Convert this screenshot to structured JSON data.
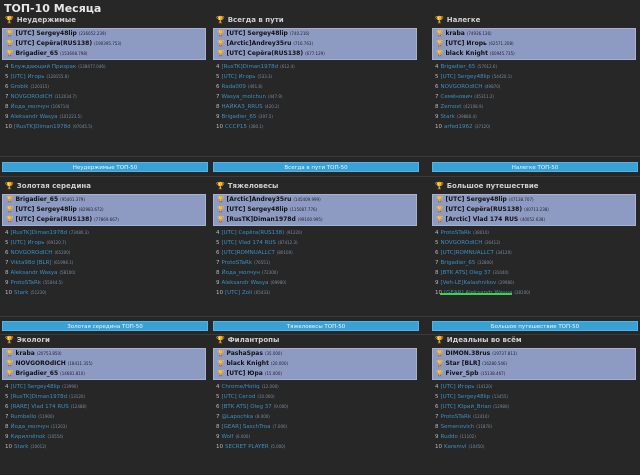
{
  "page_title": "ТОП-10 Месяца",
  "sections": [
    {
      "title": "Неудержимые",
      "top": [
        {
          "name": "[UTC] Sergey48lip",
          "score": "(236052.239)"
        },
        {
          "name": "[UTC] Cepёra(RUS138)",
          "score": "(190395.753)"
        },
        {
          "name": "Brigadier_65",
          "score": "(153608.798)"
        }
      ],
      "rest": [
        {
          "rank": "4",
          "name": "Блуждающий Призрак",
          "score": "(138477.046)"
        },
        {
          "name": "[UTC] Игорь",
          "score": "(128155.8)",
          "rank": "5"
        },
        {
          "rank": "6",
          "name": "Grobik",
          "score": "(120315)"
        },
        {
          "rank": "7",
          "name": "NOVGOROdICH",
          "score": "(112034.7)"
        },
        {
          "rank": "8",
          "name": "Йода_молчун",
          "score": "(106714)"
        },
        {
          "rank": "9",
          "name": "Aleksandr Wasya",
          "score": "(101223.5)"
        },
        {
          "rank": "10",
          "name": "[RusTK]Diman1978d",
          "score": "(97045.5)"
        }
      ],
      "button": "Неудержимые ТОП-50"
    },
    {
      "title": "Всегда в пути",
      "top": [
        {
          "name": "[UTC] Sergey48lip",
          "score": "(740.216)"
        },
        {
          "name": "[Arctic]Andrey35ru",
          "score": "(716.763)"
        },
        {
          "name": "[UTC] Cepёra(RUS138)",
          "score": "(677.129)"
        }
      ],
      "rest": [
        {
          "rank": "4",
          "name": "[RusTK]Diman1978d",
          "score": "(612.4)"
        },
        {
          "rank": "5",
          "name": "[UTC] Игорь",
          "score": "(533.3)"
        },
        {
          "rank": "6",
          "name": "Rada009",
          "score": "(491.8)"
        },
        {
          "rank": "7",
          "name": "Wasya_molchun",
          "score": "(447.9)"
        },
        {
          "rank": "8",
          "name": "НАЙКАЗ_RRUS",
          "score": "(420.2)"
        },
        {
          "rank": "9",
          "name": "Brigadier_65",
          "score": "(397.5)"
        },
        {
          "rank": "10",
          "name": "СССР15",
          "score": "(380.1)"
        }
      ],
      "button": "Всегда в пути ТОП-50"
    },
    {
      "title": "Налегке",
      "top": [
        {
          "name": "kraba",
          "score": "(74936.136)"
        },
        {
          "name": "[UTC] Игорь",
          "score": "(62571.208)"
        },
        {
          "name": "black Knight",
          "score": "(60945.735)"
        }
      ],
      "rest": [
        {
          "rank": "4",
          "name": "Brigadier_65",
          "score": "(57012.6)"
        },
        {
          "rank": "5",
          "name": "[UTC] Sergey48lip",
          "score": "(54420.1)"
        },
        {
          "rank": "6",
          "name": "NOVGOROdICH",
          "score": "(49870)"
        },
        {
          "rank": "7",
          "name": "Семёнович",
          "score": "(45311.2)"
        },
        {
          "rank": "8",
          "name": "Zemost",
          "score": "(42108.9)"
        },
        {
          "rank": "9",
          "name": "Stark",
          "score": "(39880.4)"
        },
        {
          "rank": "10",
          "name": "arfed1962",
          "score": "(37120)"
        }
      ],
      "button": "Налегке ТОП-50"
    },
    {
      "title": "Золотая середина",
      "top": [
        {
          "name": "Brigadier_65",
          "score": "(95401.379)"
        },
        {
          "name": "[UTC] Sergey48lip",
          "score": "(82983.672)"
        },
        {
          "name": "[UTC] Cepёra(RUS138)",
          "score": "(77869.667)"
        }
      ],
      "rest": [
        {
          "rank": "4",
          "name": "[RusTK]Diman1978d",
          "score": "(73480.3)"
        },
        {
          "rank": "5",
          "name": "[UTC] Игорь",
          "score": "(69120.7)"
        },
        {
          "rank": "6",
          "name": "NOVGOROdICH",
          "score": "(65200)"
        },
        {
          "rank": "7",
          "name": "Vikta98d [BLR]",
          "score": "(61998.1)"
        },
        {
          "rank": "8",
          "name": "Aleksandr Wasya",
          "score": "(58100)"
        },
        {
          "rank": "9",
          "name": "ProtoSTaRk",
          "score": "(55044.5)"
        },
        {
          "rank": "10",
          "name": "Stark",
          "score": "(51230)"
        }
      ],
      "button": "Золотая середина ТОП-50"
    },
    {
      "title": "Тяжеловесы",
      "top": [
        {
          "name": "[Arctic]Andrey35ru",
          "score": "(145409.999)"
        },
        {
          "name": "[UTC] Sergey48lip",
          "score": "(115087.776)"
        },
        {
          "name": "[RusTK]Diman1978d",
          "score": "(99160.995)"
        }
      ],
      "rest": [
        {
          "rank": "4",
          "name": "[UTC] Cepёra(RUS138)",
          "score": "(91220)"
        },
        {
          "rank": "5",
          "name": "[UTC] Vlad 174 RUS",
          "score": "(87412.3)"
        },
        {
          "rank": "6",
          "name": "[UTC]ROMNUALLCT",
          "score": "(80100)"
        },
        {
          "rank": "7",
          "name": "ProtoSTaRk",
          "score": "(76551)"
        },
        {
          "rank": "8",
          "name": "Йода_молчун",
          "score": "(72300)"
        },
        {
          "rank": "9",
          "name": "Aleksandr Wasya",
          "score": "(69980)"
        },
        {
          "rank": "10",
          "name": "[UTC] Zoli",
          "score": "(65433)"
        }
      ],
      "button": "Тяжеловесы ТОП-50"
    },
    {
      "title": "Большое путешествие",
      "top": [
        {
          "name": "[UTC] Sergey48lip",
          "score": "(47138.707)"
        },
        {
          "name": "[UTC] Cepёra(RUS138)",
          "score": "(40713.238)"
        },
        {
          "name": "[Arctic] Vlad 174 RUS",
          "score": "(40052.638)"
        }
      ],
      "rest": [
        {
          "rank": "4",
          "name": "ProtoSTaRk",
          "score": "(38010)"
        },
        {
          "rank": "5",
          "name": "NOVGOROdICH",
          "score": "(36412)"
        },
        {
          "rank": "6",
          "name": "[UTC]ROMNUALLCT",
          "score": "(34120)"
        },
        {
          "rank": "7",
          "name": "Brigadier_65",
          "score": "(32800)"
        },
        {
          "rank": "8",
          "name": "[BTK ATS] Oleg 37",
          "score": "(31040)"
        },
        {
          "rank": "9",
          "name": "[Veh-LE]Kalashnikov",
          "score": "(29980)"
        },
        {
          "rank": "10",
          "name": "[GEAR] Aleksandr Wasya",
          "score": "(28100)"
        }
      ],
      "button": "Большое путешествие ТОП-50"
    },
    {
      "title": "Экологи",
      "top": [
        {
          "name": "kraba",
          "score": "(20753.850)"
        },
        {
          "name": "NOVGOROdICH",
          "score": "(18411.355)"
        },
        {
          "name": "Brigadier_65",
          "score": "(14681.810)"
        }
      ],
      "rest": [
        {
          "rank": "4",
          "name": "[UTC] Sergey48lip",
          "score": "(13990)"
        },
        {
          "rank": "5",
          "name": "[RusTK]Diman1978d",
          "score": "(13120)"
        },
        {
          "rank": "6",
          "name": "[RARE] Vlad 174 RUS",
          "score": "(12488)"
        },
        {
          "rank": "7",
          "name": "Rumbello",
          "score": "(11900)"
        },
        {
          "rank": "8",
          "name": "Йода_молчун",
          "score": "(11203)"
        },
        {
          "rank": "9",
          "name": "Кириллёnok",
          "score": "(10554)"
        },
        {
          "rank": "10",
          "name": "Stark",
          "score": "(10012)"
        }
      ],
      "button": "Экологи ТОП-50"
    },
    {
      "title": "Филантропы",
      "top": [
        {
          "name": "PashaSpas",
          "score": "(35.000)"
        },
        {
          "name": "black Knight",
          "score": "(20.000)"
        },
        {
          "name": "[UTC] Юра",
          "score": "(15.000)"
        }
      ],
      "rest": [
        {
          "rank": "4",
          "name": "Chrome/Hotiq",
          "score": "(12.000)"
        },
        {
          "rank": "5",
          "name": "[UTC] Сегоd",
          "score": "(10.000)"
        },
        {
          "rank": "6",
          "name": "[BTK ATS] Oleg 37",
          "score": "(9.000)"
        },
        {
          "rank": "7",
          "name": "@Lapochka",
          "score": "(8.000)"
        },
        {
          "rank": "8",
          "name": "[GEAR] SaschTroa",
          "score": "(7.000)"
        },
        {
          "rank": "9",
          "name": "Wolf",
          "score": "(6.000)"
        },
        {
          "rank": "10",
          "name": "SECRET PLAYER",
          "score": "(5.000)"
        }
      ],
      "button": "Филантропы ТОП-50"
    },
    {
      "title": "Идеальны во всём",
      "top": [
        {
          "name": "DIMON.38rus",
          "score": "(19737.813)"
        },
        {
          "name": "Star [BLR]",
          "score": "(16280.546)"
        },
        {
          "name": "Fiver_Spb",
          "score": "(15138.467)"
        }
      ],
      "rest": [
        {
          "rank": "4",
          "name": "[UTC] Игорь",
          "score": "(14120)"
        },
        {
          "rank": "5",
          "name": "[UTC] Sergey48lip",
          "score": "(13455)"
        },
        {
          "rank": "6",
          "name": "[UTC] Юрий_Brian",
          "score": "(12980)"
        },
        {
          "rank": "7",
          "name": "ProtoSTaRk",
          "score": "(12410)"
        },
        {
          "rank": "8",
          "name": "Semenovich",
          "score": "(11870)"
        },
        {
          "rank": "9",
          "name": "Ruddo",
          "score": "(11102)"
        },
        {
          "rank": "10",
          "name": "Karemvl",
          "score": "(10450)"
        }
      ],
      "button": "Идеальны во всём ТОП-50"
    }
  ]
}
